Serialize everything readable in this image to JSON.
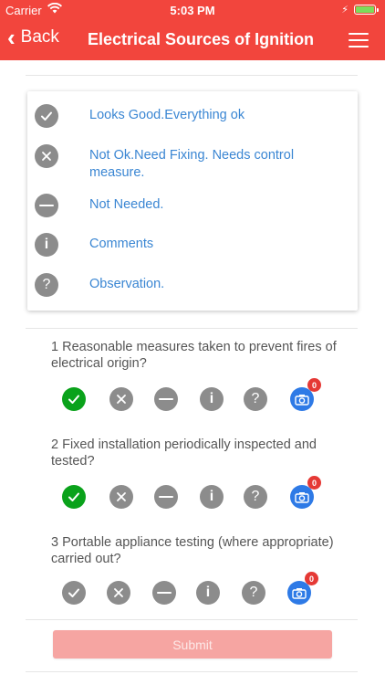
{
  "status_bar": {
    "carrier": "Carrier",
    "time": "5:03 PM"
  },
  "nav": {
    "back_label": "Back",
    "title": "Electrical Sources of Ignition"
  },
  "legend": [
    {
      "icon": "check-icon",
      "label": "Looks Good.Everything ok"
    },
    {
      "icon": "cross-icon",
      "label": "Not Ok.Need Fixing. Needs control measure."
    },
    {
      "icon": "minus-icon",
      "label": "Not Needed."
    },
    {
      "icon": "info-icon",
      "label": "Comments"
    },
    {
      "icon": "question-icon",
      "label": "Observation."
    }
  ],
  "questions": [
    {
      "text": "1 Reasonable measures taken to prevent fires of electrical origin?",
      "selected": "check",
      "photo_count": "0"
    },
    {
      "text": "2 Fixed installation periodically inspected and tested?",
      "selected": "check",
      "photo_count": "0"
    },
    {
      "text": "3 Portable appliance testing (where appropriate) carried out?",
      "selected": "none",
      "photo_count": "0"
    }
  ],
  "glyphs": {
    "info": "i",
    "question": "?"
  },
  "submit_label": "Submit",
  "colors": {
    "header": "#f2453d",
    "link": "#3a86d3",
    "selected": "#0aa21b",
    "camera": "#2e7ae6",
    "badge": "#e53935",
    "submit": "#f6a5a2"
  }
}
